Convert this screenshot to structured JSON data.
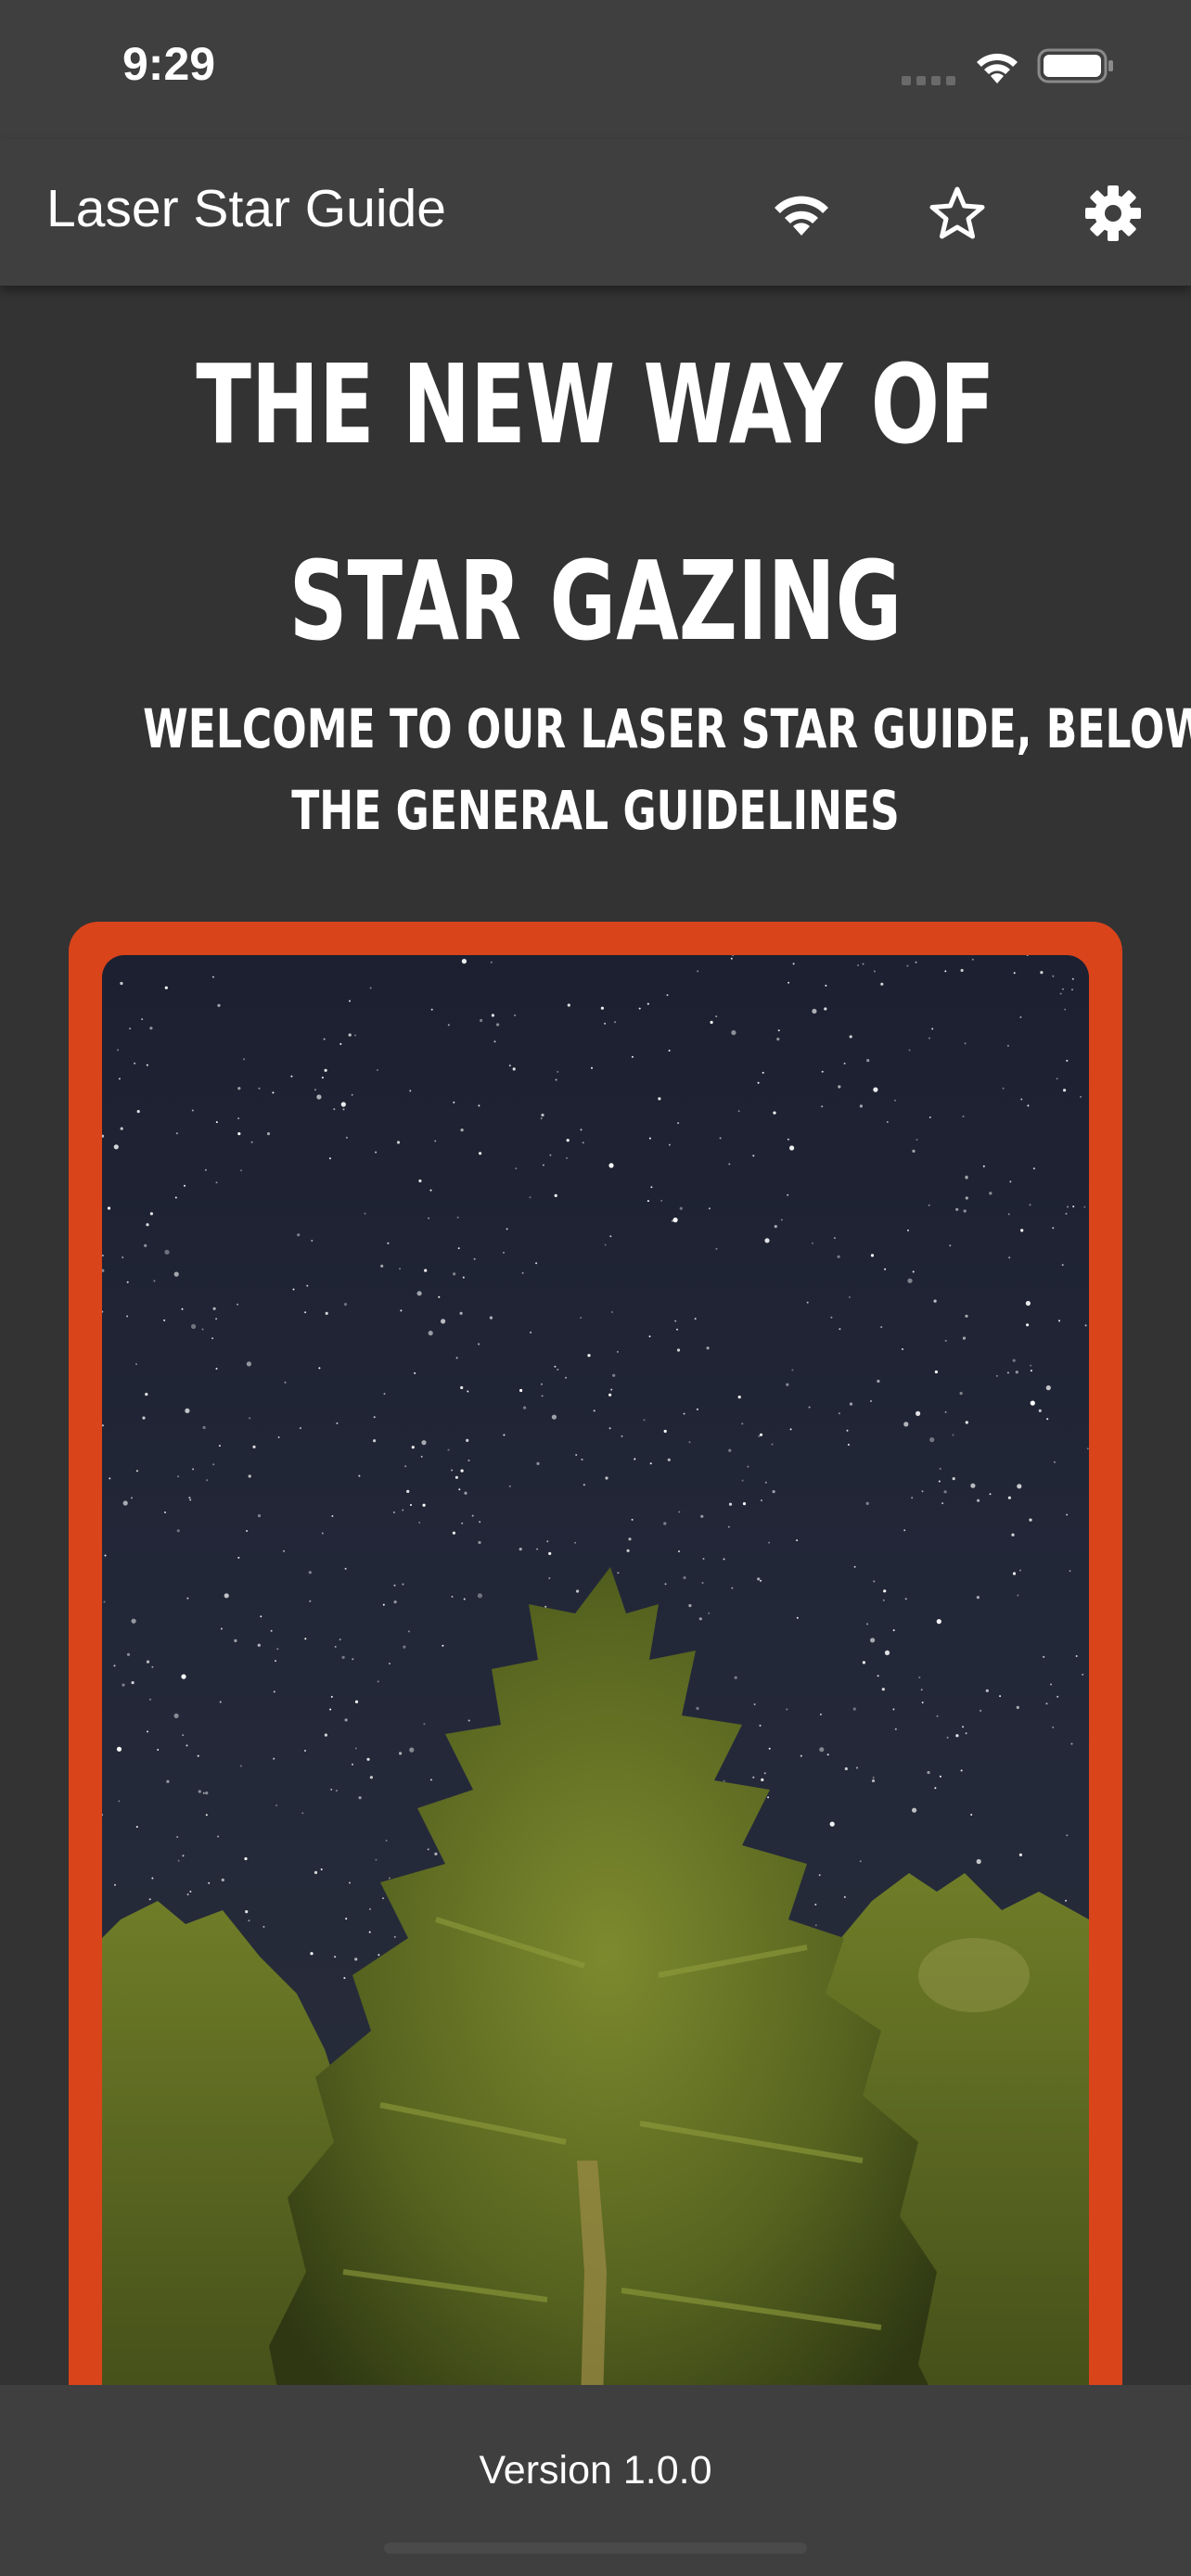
{
  "status_bar": {
    "time": "9:29",
    "icons": [
      "cellular-signal-icon",
      "wifi-icon",
      "battery-icon"
    ]
  },
  "app_bar": {
    "title": "Laser Star Guide",
    "actions": [
      {
        "name": "wifi-button",
        "icon": "wifi-icon"
      },
      {
        "name": "favorite-button",
        "icon": "star-outline-icon"
      },
      {
        "name": "settings-button",
        "icon": "gear-icon"
      }
    ]
  },
  "hero": {
    "headline_line1": "THE NEW WAY OF",
    "headline_line2": "STAR GAZING",
    "subhead_line1": "WELCOME TO OUR LASER STAR GUIDE, BELOW ARE",
    "subhead_line2": "THE GENERAL GUIDELINES"
  },
  "photo_card": {
    "frame_color": "#d9441b",
    "image": "night-sky-with-pine-trees"
  },
  "footer": {
    "version": "Version 1.0.0"
  },
  "colors": {
    "background": "#333333",
    "bars": "#3f3f3f",
    "text": "#ffffff",
    "accent": "#d9441b"
  }
}
